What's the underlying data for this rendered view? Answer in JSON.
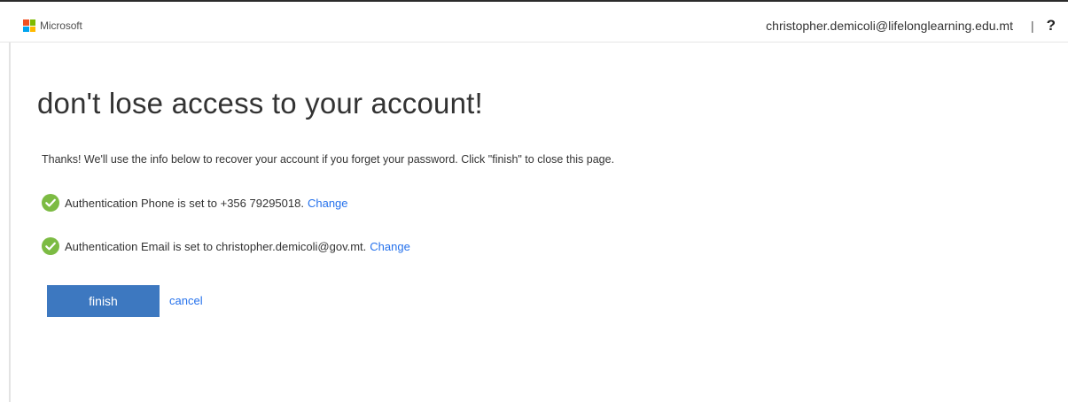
{
  "header": {
    "brand": "Microsoft",
    "user_email": "christopher.demicoli@lifelonglearning.edu.mt",
    "separator": "|",
    "help": "?"
  },
  "main": {
    "title": "don't lose access to your account!",
    "intro": "Thanks! We'll use the info below to recover your account if you forget your password. Click \"finish\" to close this page.",
    "items": [
      {
        "text": "Authentication Phone is set to +356 79295018.",
        "link": "Change",
        "icon": "check-circle-icon"
      },
      {
        "text": "Authentication Email is set to christopher.demicoli@gov.mt.",
        "link": "Change",
        "icon": "check-circle-icon"
      }
    ],
    "finish_label": "finish",
    "cancel_label": "cancel"
  },
  "colors": {
    "accent": "#3d78c0",
    "link": "#2672ec",
    "check": "#7cbb43",
    "logo": [
      "#f25022",
      "#7fba00",
      "#00a4ef",
      "#ffb900"
    ]
  }
}
